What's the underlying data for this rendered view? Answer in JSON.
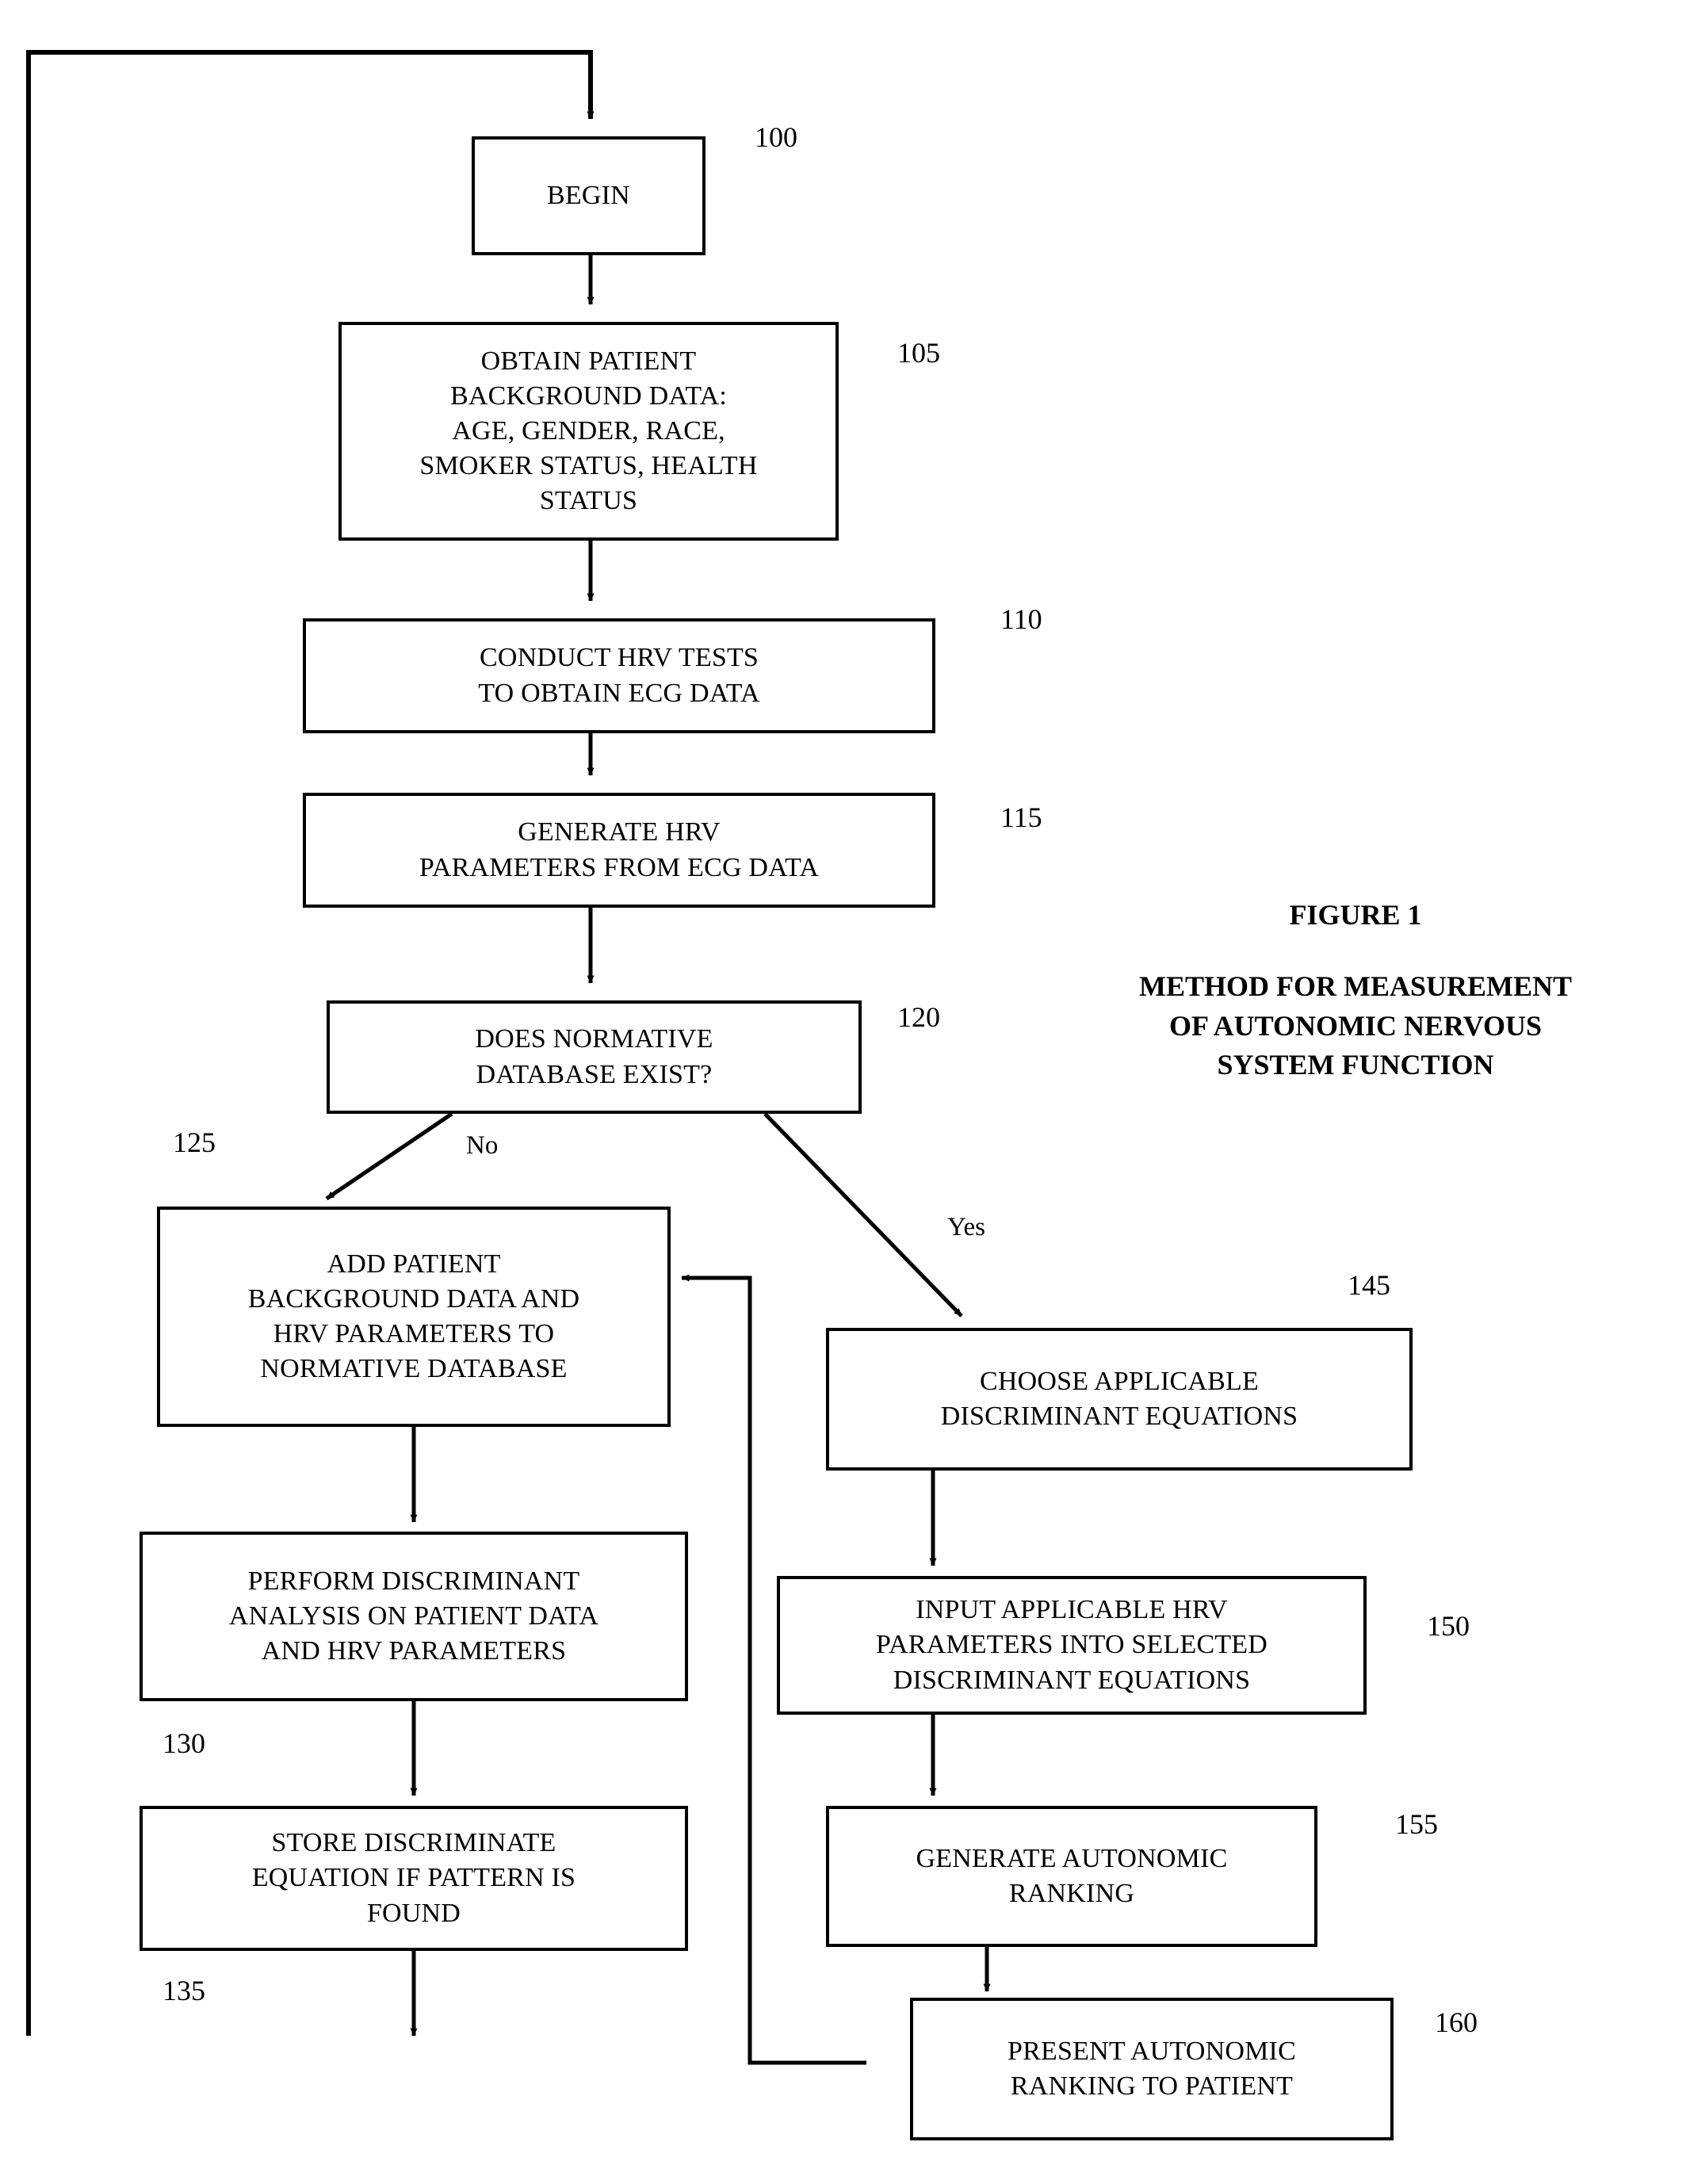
{
  "figure": {
    "caption_title": "FIGURE 1",
    "caption_subtitle": "METHOD FOR MEASUREMENT\nOF AUTONOMIC NERVOUS\nSYSTEM FUNCTION"
  },
  "nodes": {
    "begin": {
      "label": "BEGIN",
      "ref": "100"
    },
    "obtain_background": {
      "label": "OBTAIN PATIENT\nBACKGROUND DATA:\nAGE, GENDER, RACE,\nSMOKER STATUS, HEALTH\nSTATUS",
      "ref": "105"
    },
    "conduct_hrv": {
      "label": "CONDUCT HRV TESTS\nTO OBTAIN ECG DATA",
      "ref": "110"
    },
    "generate_hrv_params": {
      "label": "GENERATE HRV\nPARAMETERS FROM ECG DATA",
      "ref": "115"
    },
    "decision_normative_db": {
      "label": "DOES NORMATIVE\nDATABASE EXIST?",
      "ref": "120"
    },
    "add_patient_data": {
      "label": "ADD PATIENT\nBACKGROUND DATA AND\nHRV PARAMETERS TO\nNORMATIVE DATABASE",
      "ref": "125"
    },
    "perform_discriminant": {
      "label": "PERFORM DISCRIMINANT\nANALYSIS ON PATIENT DATA\nAND HRV PARAMETERS",
      "ref": "130"
    },
    "store_equation": {
      "label": "STORE DISCRIMINATE\nEQUATION IF PATTERN IS\nFOUND",
      "ref": "135"
    },
    "choose_equations": {
      "label": "CHOOSE APPLICABLE\nDISCRIMINANT EQUATIONS",
      "ref": "145"
    },
    "input_params": {
      "label": "INPUT APPLICABLE HRV\nPARAMETERS INTO SELECTED\nDISCRIMINANT EQUATIONS",
      "ref": "150"
    },
    "generate_ranking": {
      "label": "GENERATE AUTONOMIC\nRANKING",
      "ref": "155"
    },
    "present_ranking": {
      "label": "PRESENT AUTONOMIC\nRANKING TO PATIENT",
      "ref": "160"
    }
  },
  "branches": {
    "no_label": "No",
    "yes_label": "Yes"
  },
  "colors": {
    "stroke": "#000000",
    "background": "#ffffff"
  }
}
